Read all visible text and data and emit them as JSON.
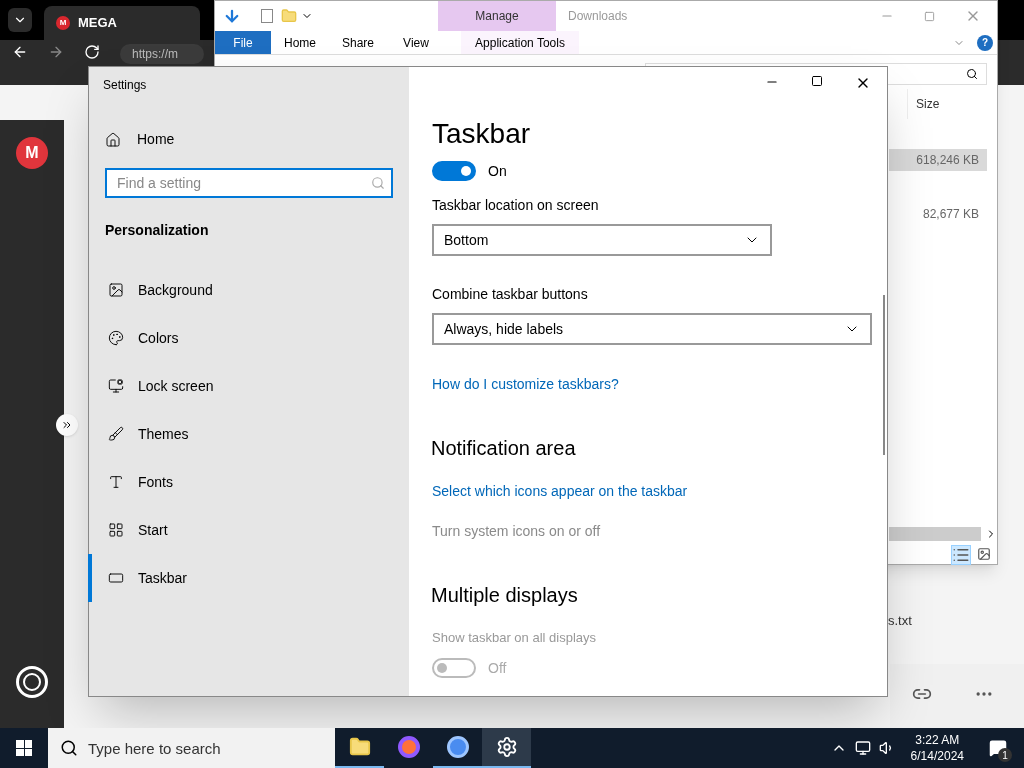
{
  "browser": {
    "tab_logo": "M",
    "tab_title": "MEGA",
    "address": "https://m"
  },
  "explorer": {
    "title": "Downloads",
    "contextual_group": "Manage",
    "ribbon_tabs": [
      {
        "label": "File",
        "kind": "file",
        "selected": false
      },
      {
        "label": "Home",
        "kind": "tab",
        "selected": false
      },
      {
        "label": "Share",
        "kind": "tab",
        "selected": false
      },
      {
        "label": "View",
        "kind": "tab",
        "selected": false
      },
      {
        "label": "Application Tools",
        "kind": "contextual",
        "selected": false
      }
    ],
    "help": "?",
    "column": "Size",
    "rows": [
      {
        "size": "618,246 KB",
        "selected": true
      },
      {
        "size": "82,677 KB",
        "selected": false
      }
    ]
  },
  "mega": {
    "logo": "M",
    "file_name": "s.txt"
  },
  "settings": {
    "title": "Settings",
    "home": "Home",
    "search": {
      "placeholder": "Find a setting"
    },
    "section": "Personalization",
    "nav": [
      {
        "label": "Background",
        "selected": false
      },
      {
        "label": "Colors",
        "selected": false
      },
      {
        "label": "Lock screen",
        "selected": false
      },
      {
        "label": "Themes",
        "selected": false
      },
      {
        "label": "Fonts",
        "selected": false
      },
      {
        "label": "Start",
        "selected": false
      },
      {
        "label": "Taskbar",
        "selected": true
      }
    ],
    "page_title": "Taskbar",
    "items": [
      {
        "kind": "toggle",
        "on": true,
        "disabled": false,
        "state_label": "On"
      },
      {
        "kind": "dropdown",
        "label": "Taskbar location on screen",
        "value": "Bottom"
      },
      {
        "kind": "dropdown",
        "label": "Combine taskbar buttons",
        "value": "Always, hide labels"
      },
      {
        "kind": "link",
        "text": "How do I customize taskbars?",
        "disabled": false
      },
      {
        "kind": "heading",
        "text": "Notification area"
      },
      {
        "kind": "link",
        "text": "Select which icons appear on the taskbar",
        "disabled": false
      },
      {
        "kind": "link",
        "text": "Turn system icons on or off",
        "disabled": true
      },
      {
        "kind": "heading",
        "text": "Multiple displays"
      },
      {
        "kind": "label",
        "text": "Show taskbar on all displays",
        "disabled": true
      },
      {
        "kind": "toggle",
        "on": false,
        "disabled": true,
        "state_label": "Off"
      }
    ]
  },
  "taskbar": {
    "search": {
      "placeholder": "Type here to search"
    },
    "apps": [
      {
        "running": true,
        "selected": false
      },
      {
        "running": false,
        "selected": false
      },
      {
        "running": true,
        "selected": false
      },
      {
        "running": true,
        "selected": true
      }
    ],
    "time": "3:22 AM",
    "date": "6/14/2024",
    "notifications": "1"
  }
}
